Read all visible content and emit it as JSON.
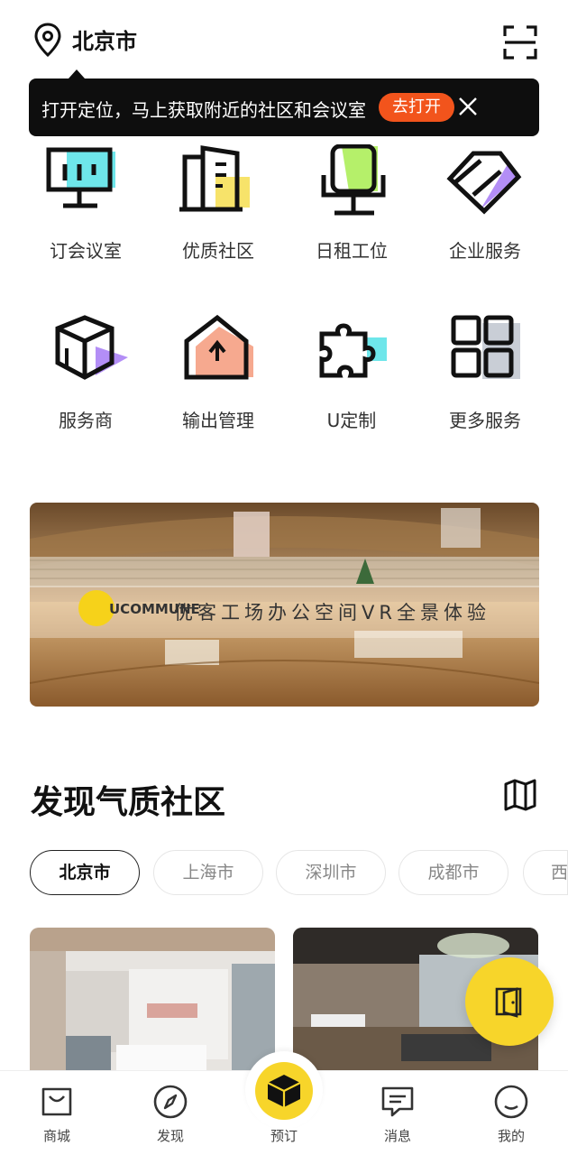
{
  "header": {
    "city": "北京市",
    "location_icon": "location-pin-icon",
    "scan_icon": "scan-icon"
  },
  "location_tip": {
    "text": "打开定位，马上获取附近的社区和会议室",
    "button_label": "去打开",
    "close_icon": "close-icon"
  },
  "services": [
    {
      "label": "订会议室",
      "icon": "meeting-room-icon",
      "accent": "#6ee6ea"
    },
    {
      "label": "优质社区",
      "icon": "building-icon",
      "accent": "#f7e36a"
    },
    {
      "label": "日租工位",
      "icon": "chair-icon",
      "accent": "#b5f06a"
    },
    {
      "label": "企业服务",
      "icon": "diamond-icon",
      "accent": "#b38ef6"
    },
    {
      "label": "服务商",
      "icon": "box-icon",
      "accent": "#b38ef6"
    },
    {
      "label": "输出管理",
      "icon": "house-arrow-icon",
      "accent": "#f6a98f"
    },
    {
      "label": "U定制",
      "icon": "puzzle-icon",
      "accent": "#6ee6ea"
    },
    {
      "label": "更多服务",
      "icon": "grid-icon",
      "accent": "#c9ced6"
    }
  ],
  "banner": {
    "brand": "UCOMMUNE",
    "text": "优客工场办公空间VR全景体验"
  },
  "section": {
    "title": "发现气质社区",
    "map_icon": "map-icon"
  },
  "city_tabs": [
    {
      "label": "北京市",
      "active": true
    },
    {
      "label": "上海市",
      "active": false
    },
    {
      "label": "深圳市",
      "active": false
    },
    {
      "label": "成都市",
      "active": false
    },
    {
      "label": "西",
      "active": false
    }
  ],
  "fab": {
    "icon": "door-icon"
  },
  "tabbar": [
    {
      "label": "商城",
      "icon": "shopping-bag-icon"
    },
    {
      "label": "发现",
      "icon": "compass-icon"
    },
    {
      "label": "预订",
      "icon": "cube-icon"
    },
    {
      "label": "消息",
      "icon": "message-icon"
    },
    {
      "label": "我的",
      "icon": "profile-icon"
    }
  ],
  "colors": {
    "accent_yellow": "#f7d52a",
    "tip_button": "#f2541c",
    "tip_background": "#0e0e0e"
  }
}
